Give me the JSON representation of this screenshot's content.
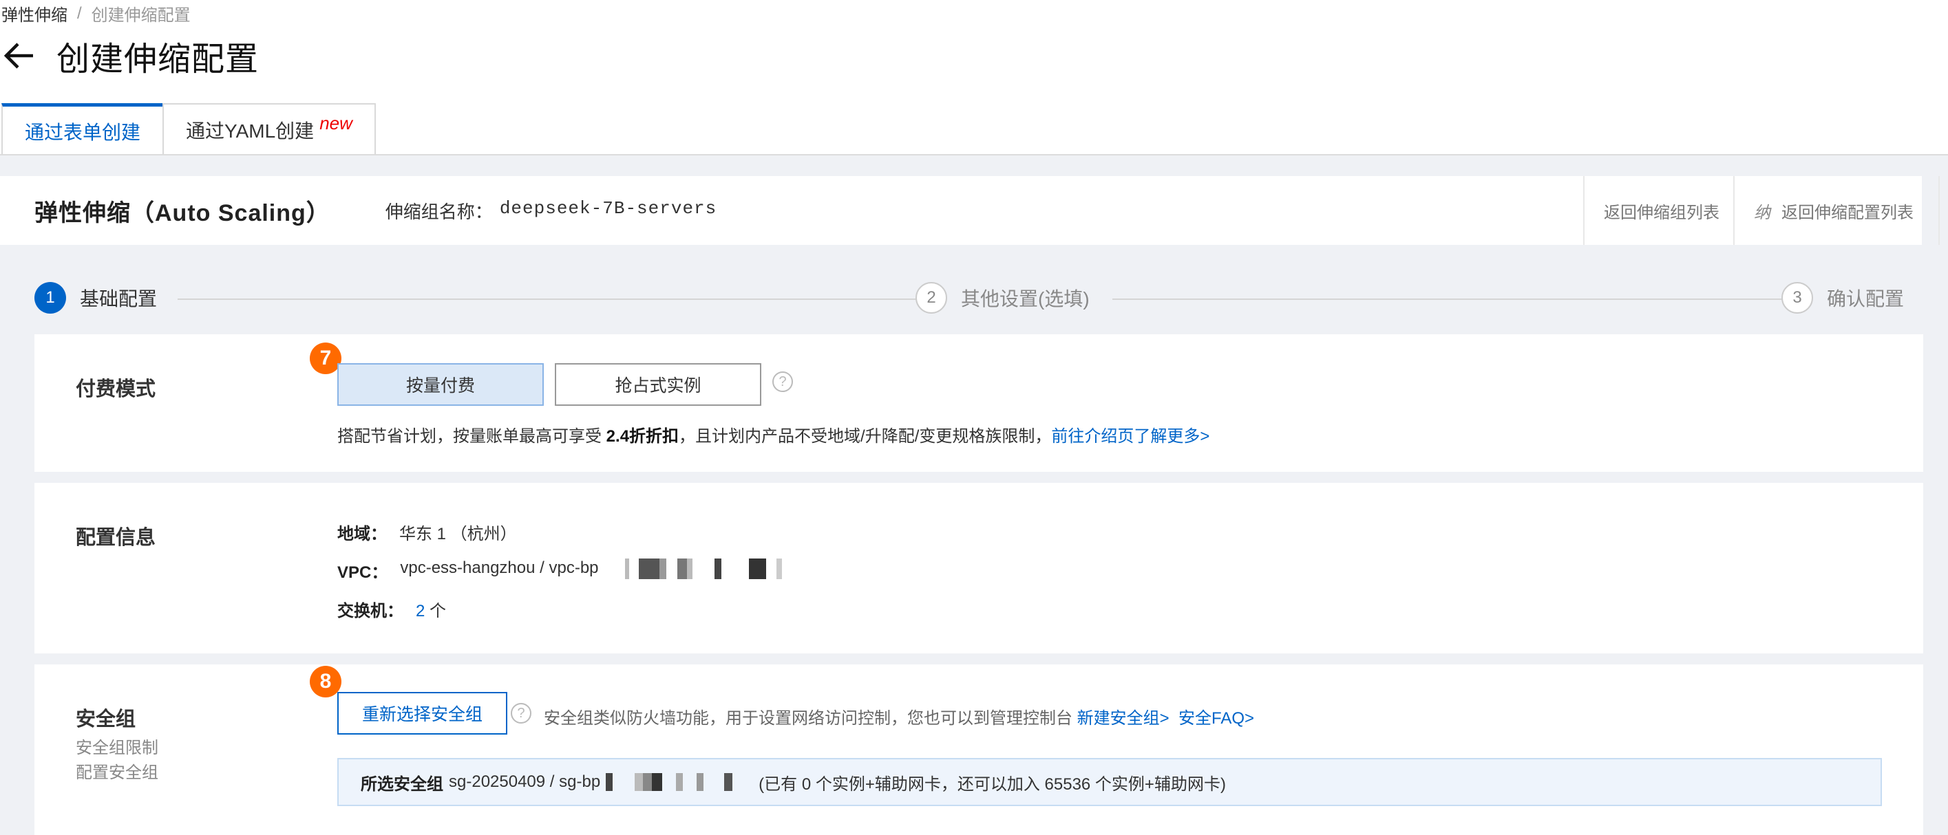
{
  "breadcrumb": {
    "parent": "弹性伸缩",
    "separator": "/",
    "current": "创建伸缩配置"
  },
  "page": {
    "title": "创建伸缩配置"
  },
  "tabs": [
    {
      "label": "通过表单创建",
      "active": true
    },
    {
      "label": "通过YAML创建",
      "badge": "new",
      "active": false
    }
  ],
  "header": {
    "title": "弹性伸缩（Auto Scaling）",
    "group_label": "伸缩组名称：",
    "group_name": "deepseek-7B-servers",
    "link_back_group": "返回伸缩组列表",
    "link_back_config_icon": "纳",
    "link_back_config": "返回伸缩配置列表"
  },
  "steps": [
    {
      "num": "1",
      "label": "基础配置",
      "active": true
    },
    {
      "num": "2",
      "label": "其他设置(选填)",
      "active": false
    },
    {
      "num": "3",
      "label": "确认配置",
      "active": false
    }
  ],
  "billing": {
    "label": "付费模式",
    "badge": "7",
    "options": [
      "按量付费",
      "抢占式实例"
    ],
    "selected": "按量付费",
    "help": "?",
    "desc_prefix": "搭配节省计划，按量账单最高可享受 ",
    "desc_bold": "2.4折折扣",
    "desc_suffix": "，且计划内产品不受地域/升降配/变更规格族限制，",
    "desc_link": "前往介绍页了解更多>"
  },
  "config": {
    "label": "配置信息",
    "region_key": "地域：",
    "region_val": "华东 1 （杭州）",
    "vpc_key": "VPC：",
    "vpc_val": "vpc-ess-hangzhou / vpc-bp",
    "vswitch_key": "交换机：",
    "vswitch_count": "2",
    "vswitch_unit": "个"
  },
  "security": {
    "label": "安全组",
    "sub1": "安全组限制",
    "sub2": "配置安全组",
    "badge": "8",
    "button": "重新选择安全组",
    "help": "?",
    "desc": "安全组类似防火墙功能，用于设置网络访问控制，您也可以到管理控制台",
    "link_new": "新建安全组>",
    "link_faq": "安全FAQ>",
    "selected_key": "所选安全组",
    "selected_val": "sg-20250409 / sg-bp",
    "selected_suffix": "(已有 0 个实例+辅助网卡，还可以加入 65536 个实例+辅助网卡)"
  },
  "colors": {
    "primary": "#0064c8",
    "badge": "#ff6a00",
    "new_badge": "#e00000",
    "page_bg": "#eff1f5"
  }
}
